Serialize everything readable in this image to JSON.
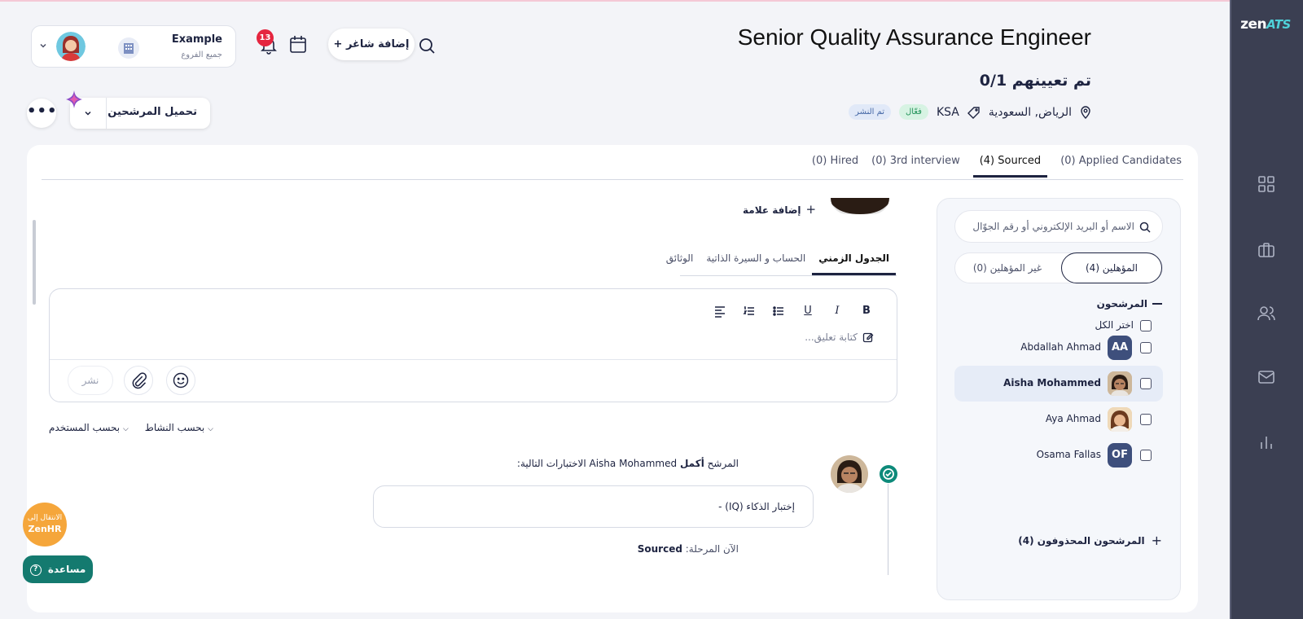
{
  "app": {
    "logo_main": "zen",
    "logo_sub": "ATS"
  },
  "user": {
    "name": "Example",
    "branch": "جميع الفروع"
  },
  "notifications": {
    "count": "13"
  },
  "header": {
    "add_vacancy": "+ إضافة شاغر"
  },
  "job": {
    "title": "Senior Quality Assurance Engineer",
    "hired": "0/1 تم تعيينهم",
    "location": "الرياض, السعودية",
    "tag": "KSA",
    "status_active": "فعّال",
    "status_published": "تم النشر"
  },
  "actions": {
    "load_candidates": "تحميل المرشحين",
    "more": "•••"
  },
  "stage_tabs": [
    {
      "label": "Applied Candidates",
      "count": "(0)"
    },
    {
      "label": "Sourced",
      "count": "(4)"
    },
    {
      "label": "3rd interview",
      "count": "(0)"
    },
    {
      "label": "Hired",
      "count": "(0)"
    }
  ],
  "candidates_panel": {
    "search_placeholder": "الاسم أو البريد الإلكتروني أو رقم الجوّال",
    "qualified": "المؤهلين (4)",
    "unqualified": "غير المؤهلين (0)",
    "group_title": "المرشحون",
    "select_all": "اختر الكل",
    "items": [
      {
        "name": "Abdallah Ahmad",
        "initials": "AA"
      },
      {
        "name": "Aisha Mohammed",
        "initials": ""
      },
      {
        "name": "Aya Ahmad",
        "initials": ""
      },
      {
        "name": "Osama Fallas",
        "initials": "OF"
      }
    ],
    "deleted": "المرشحون المحذوفون (4)"
  },
  "profile": {
    "add_tag": "إضافة علامة",
    "tabs": [
      "الجدول الزمني",
      "الحساب و السيرة الذاتية",
      "الوثائق"
    ]
  },
  "editor": {
    "placeholder": "كتابة تعليق...",
    "publish": "نشر"
  },
  "filters": {
    "by_activity": "بحسب النشاط",
    "by_user": "بحسب المستخدم"
  },
  "timeline": {
    "event_prefix": "المرشح",
    "event_verb": "أكمل",
    "event_candidate": "Aisha Mohammed",
    "event_suffix": "الاختبارات التالية:",
    "test_item": "إختبار الذكاء (IQ) -",
    "stage_label": "الآن المرحلة:",
    "stage_value": "Sourced"
  },
  "floating": {
    "goto": "الانتقال إلى",
    "zenhr": "ZenHR",
    "help": "مساعدة"
  },
  "colors": {
    "sidebar": "#3b3f52",
    "accent": "#4fd1d9",
    "primary": "#1d2340",
    "active_green": "#1e9156",
    "badge_red": "#e5253f",
    "help_teal": "#147a6f",
    "zenhr_orange": "#f5a63b"
  }
}
